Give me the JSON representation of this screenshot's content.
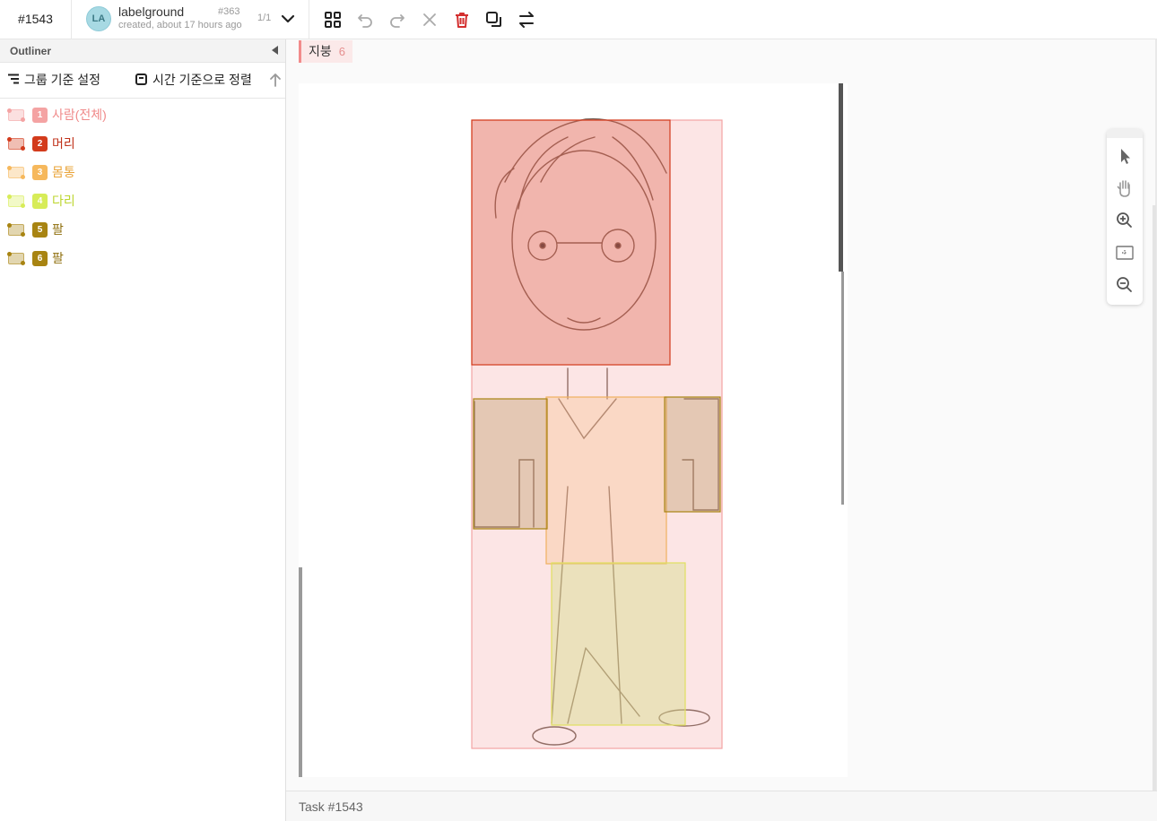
{
  "header": {
    "task_id": "#1543",
    "user": {
      "avatar_initials": "LA",
      "name": "labelground",
      "subtitle": "created, about 17 hours ago",
      "project_no": "#363",
      "page_count": "1/1"
    },
    "tools": [
      {
        "name": "grid-icon",
        "color": "#222222",
        "enabled": true
      },
      {
        "name": "undo-icon",
        "color": "#aaaaaa",
        "enabled": false
      },
      {
        "name": "redo-icon",
        "color": "#aaaaaa",
        "enabled": false
      },
      {
        "name": "close-icon",
        "color": "#aaaaaa",
        "enabled": false
      },
      {
        "name": "trash-icon",
        "color": "#d32f2f",
        "enabled": true
      },
      {
        "name": "copy-icon",
        "color": "#222222",
        "enabled": true
      },
      {
        "name": "swap-icon",
        "color": "#222222",
        "enabled": true
      }
    ]
  },
  "sidebar": {
    "title": "Outliner",
    "group_label": "그룹 기준 설정",
    "sort_label": "시간 기준으로 정렬",
    "annotations": [
      {
        "number": "1",
        "label": "사람(전체)",
        "color": "#f4a3a3",
        "text_color": "#f08a8a"
      },
      {
        "number": "2",
        "label": "머리",
        "color": "#d33b1c",
        "text_color": "#c0321a"
      },
      {
        "number": "3",
        "label": "몸통",
        "color": "#f6b85c",
        "text_color": "#eaa43a"
      },
      {
        "number": "4",
        "label": "다리",
        "color": "#d7ec58",
        "text_color": "#bdd630"
      },
      {
        "number": "5",
        "label": "팔",
        "color": "#a88412",
        "text_color": "#8f6f0e"
      },
      {
        "number": "6",
        "label": "팔",
        "color": "#a88412",
        "text_color": "#8f6f0e"
      }
    ]
  },
  "main": {
    "class_chip": {
      "name": "지붕",
      "count": "6"
    },
    "zoom_tools": [
      "pointer-icon",
      "hand-icon",
      "zoom-in-icon",
      "fit-screen-icon",
      "zoom-out-icon"
    ],
    "footer_text": "Task #1543"
  }
}
